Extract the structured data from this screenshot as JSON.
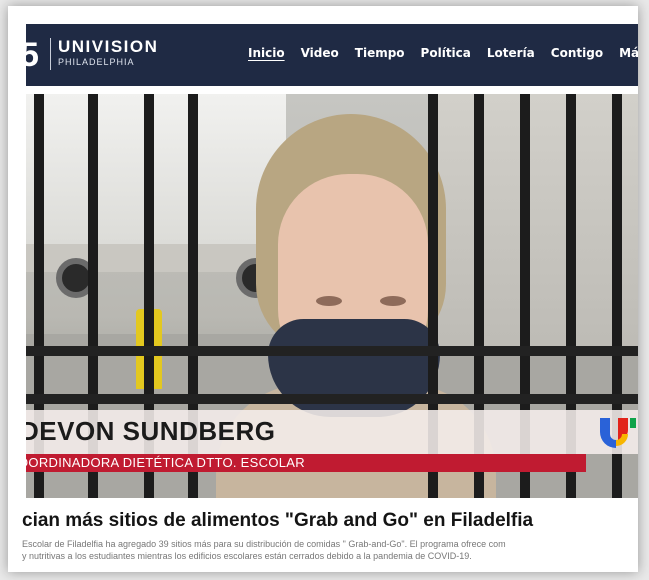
{
  "header": {
    "logo_number": "5",
    "brand_name": "UNIVISION",
    "brand_city": "PHILADELPHIA",
    "nav": [
      {
        "label": "Inicio",
        "active": true
      },
      {
        "label": "Video"
      },
      {
        "label": "Tiempo"
      },
      {
        "label": "Política"
      },
      {
        "label": "Lotería"
      },
      {
        "label": "Contigo"
      },
      {
        "label": "Más"
      }
    ],
    "more_icon": "chevron-down-icon"
  },
  "video": {
    "lower_third_name": "DEVON SUNDBERG",
    "lower_third_title": "OORDINADORA DIETÉTICA DTTO. ESCOLAR",
    "channel_logo": "univision-logo",
    "colors": {
      "nav_bg": "#1f2a44",
      "title_bar": "#c01b31",
      "mask": "#2c3447"
    }
  },
  "article": {
    "headline": "cian más sitios de alimentos \"Grab and Go\" en Filadelfia",
    "summary_line1": "Escolar de Filadelfia ha agregado 39 sitios más para su distribución de comidas \" Grab-and-Go\". El programa ofrece com",
    "summary_line2": "y nutritivas a los estudiantes mientras los edificios escolares están cerrados debido a la pandemia de COVID-19."
  }
}
